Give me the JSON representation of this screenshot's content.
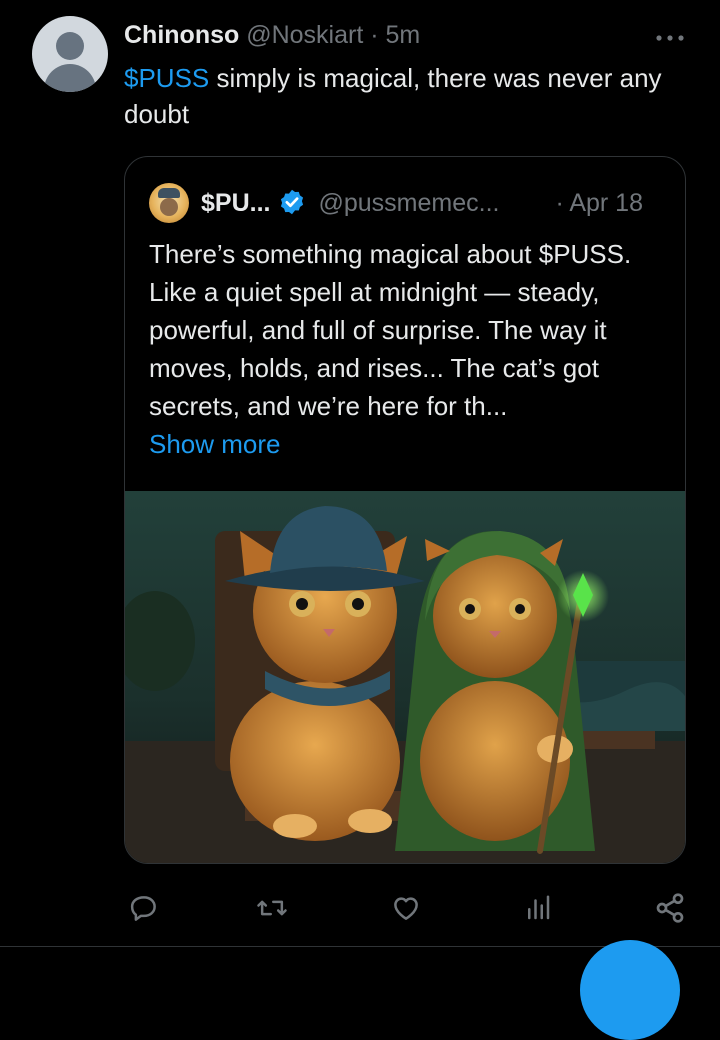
{
  "tweet": {
    "author_name": "Chinonso",
    "author_handle": "@Noskiart",
    "separator": "·",
    "time": "5m",
    "text_cashtag": "$PUSS",
    "text_rest": " simply is magical, there was never any doubt"
  },
  "quote": {
    "name": "$PU...",
    "handle": "@pussmemec...",
    "date": "· Apr 18",
    "text": "There’s something magical about $PUSS. Like a quiet spell at midnight — steady, powerful, and full of surprise. The way it moves, holds, and rises... The cat’s got secrets, and we’re here for th...",
    "show_more": "Show more"
  },
  "icons": {
    "more": "more-horizontal-icon",
    "reply": "reply-icon",
    "retweet": "retweet-icon",
    "like": "heart-icon",
    "views": "views-icon",
    "share": "share-icon",
    "verified": "verified-badge-icon"
  },
  "colors": {
    "background": "#000000",
    "accent": "#1d9bf0",
    "text": "#e7e9ea",
    "muted": "#71767b",
    "border": "#2f3336"
  }
}
